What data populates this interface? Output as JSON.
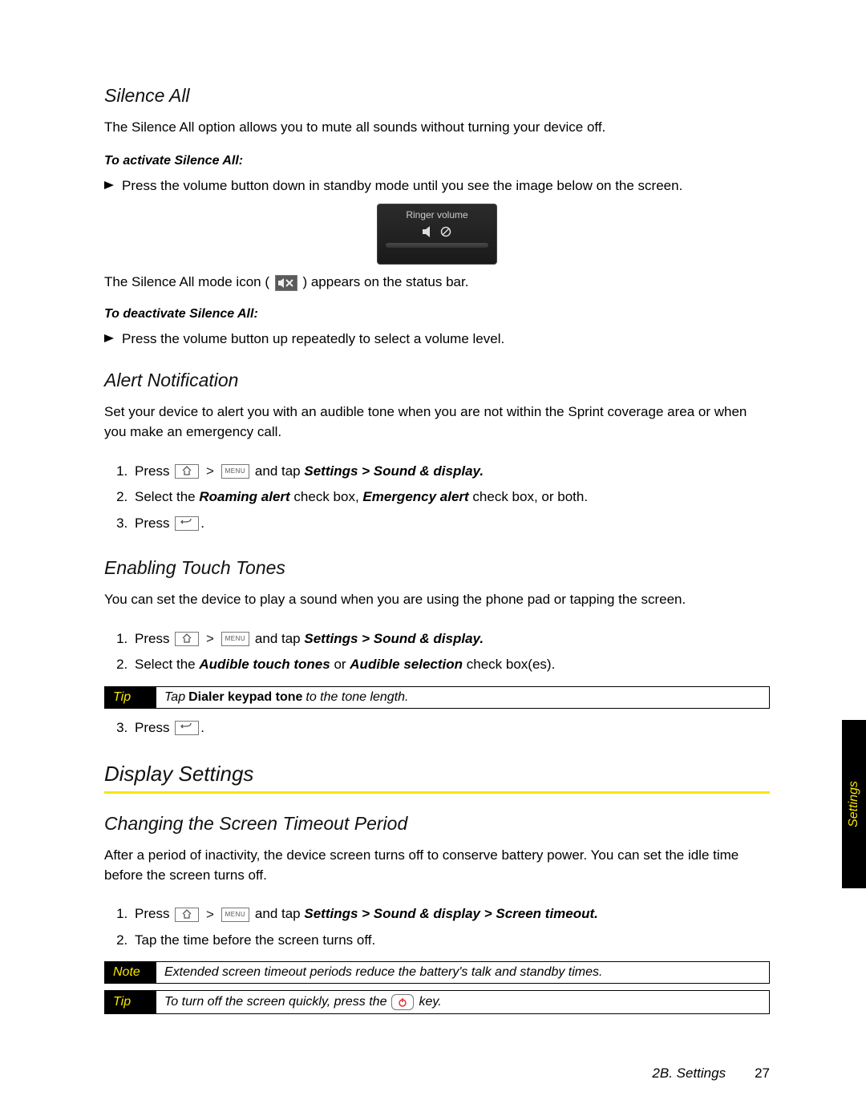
{
  "sideTab": "Settings",
  "silenceAll": {
    "heading": "Silence All",
    "intro": "The Silence All option allows you to mute all sounds without turning your device off.",
    "activateLabel": "To activate Silence All:",
    "activateStep": "Press the volume button down in standby mode until you see the image below on the screen.",
    "ringerLabel": "Ringer volume",
    "statusPrefix": "The Silence All mode icon (",
    "statusSuffix": ") appears on the status bar.",
    "deactivateLabel": "To deactivate Silence All:",
    "deactivateStep": "Press the volume button up repeatedly to select a volume level."
  },
  "alert": {
    "heading": "Alert Notification",
    "intro": "Set your device to alert you with an audible tone when you are not within the Sprint coverage area or when you make an emergency call.",
    "step1_press": "Press",
    "step1_andtap": "and tap",
    "step1_path": "Settings > Sound & display.",
    "step2_a": "Select the ",
    "step2_b": "Roaming alert",
    "step2_c": " check box, ",
    "step2_d": "Emergency alert",
    "step2_e": " check box, or both.",
    "step3": "Press"
  },
  "touch": {
    "heading": "Enabling Touch Tones",
    "intro": "You can set the device to play a sound when you are using the phone pad or tapping the screen.",
    "step1_press": "Press",
    "step1_andtap": "and tap",
    "step1_path": "Settings > Sound & display.",
    "step2_a": "Select the ",
    "step2_b": "Audible touch tones",
    "step2_c": " or ",
    "step2_d": "Audible selection",
    "step2_e": " check box(es).",
    "tipTag": "Tip",
    "tip_a": "Tap ",
    "tip_b": "Dialer keypad tone",
    "tip_c": " to the tone length.",
    "step3": "Press"
  },
  "display": {
    "heading": "Display Settings",
    "subheading": "Changing the Screen Timeout Period",
    "intro": "After a period of inactivity, the device screen turns off to conserve battery power. You can set the idle time before the screen turns off.",
    "step1_press": "Press",
    "step1_andtap": "and tap",
    "step1_path": "Settings > Sound & display > Screen timeout.",
    "step2": "Tap the time before the screen turns off.",
    "noteTag": "Note",
    "note": "Extended screen timeout periods reduce the battery's talk and standby times.",
    "tipTag": "Tip",
    "tip_a": "To turn off the screen quickly, press the ",
    "tip_b": " key."
  },
  "keys": {
    "menu": "MENU"
  },
  "footer": {
    "section": "2B. Settings",
    "page": "27"
  }
}
